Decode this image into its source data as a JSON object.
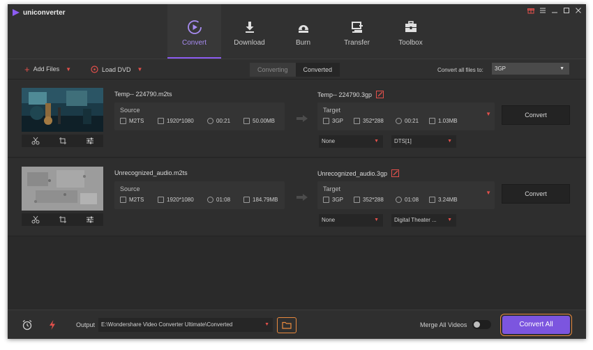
{
  "app": {
    "title": "uniconverter"
  },
  "window_controls": [
    "gift-icon",
    "menu-icon",
    "minimize-icon",
    "maximize-icon",
    "close-icon"
  ],
  "nav": {
    "tabs": [
      {
        "label": "Convert",
        "icon": "convert-icon",
        "active": true
      },
      {
        "label": "Download",
        "icon": "download-icon",
        "active": false
      },
      {
        "label": "Burn",
        "icon": "burn-icon",
        "active": false
      },
      {
        "label": "Transfer",
        "icon": "transfer-icon",
        "active": false
      },
      {
        "label": "Toolbox",
        "icon": "toolbox-icon",
        "active": false
      }
    ]
  },
  "toolbar": {
    "add_files": "Add Files",
    "load_dvd": "Load DVD",
    "segments": [
      "Converting",
      "Converted"
    ],
    "convert_all_to_label": "Convert all files to:",
    "convert_all_to_value": "3GP"
  },
  "items": [
    {
      "source_name": "Temp-- 224790.m2ts",
      "source_label": "Source",
      "source": {
        "format": "M2TS",
        "resolution": "1920*1080",
        "duration": "00:21",
        "size": "50.00MB"
      },
      "target_name": "Temp-- 224790.3gp",
      "target_label": "Target",
      "target": {
        "format": "3GP",
        "resolution": "352*288",
        "duration": "00:21",
        "size": "1.03MB"
      },
      "subtitle": "None",
      "audio": "DTS[1]",
      "convert_label": "Convert"
    },
    {
      "source_name": "Unrecognized_audio.m2ts",
      "source_label": "Source",
      "source": {
        "format": "M2TS",
        "resolution": "1920*1080",
        "duration": "01:08",
        "size": "184.79MB"
      },
      "target_name": "Unrecognized_audio.3gp",
      "target_label": "Target",
      "target": {
        "format": "3GP",
        "resolution": "352*288",
        "duration": "01:08",
        "size": "3.24MB"
      },
      "subtitle": "None",
      "audio": "Digital Theater ...",
      "convert_label": "Convert"
    }
  ],
  "footer": {
    "output_label": "Output",
    "output_path": "E:\\Wondershare Video Converter Ultimate\\Converted",
    "merge_label": "Merge All Videos",
    "merge_on": false,
    "convert_all": "Convert All"
  },
  "colors": {
    "accent": "#8c5cf2",
    "highlight": "#e98a3e",
    "dropdown": "#e2504b"
  }
}
